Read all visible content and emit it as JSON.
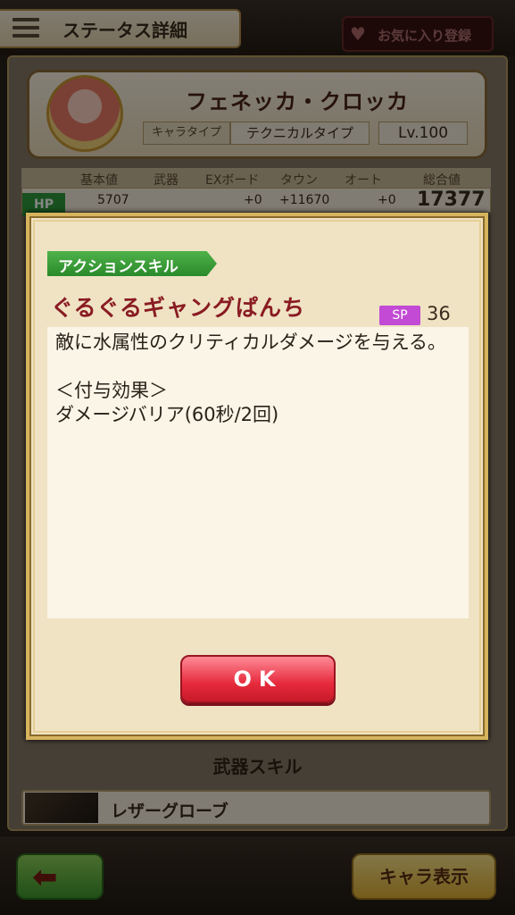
{
  "header": {
    "title": "ステータス詳細",
    "favorite_label": "お気に入り登録"
  },
  "character": {
    "name": "フェネッカ・クロッカ",
    "type_label": "キャラタイプ",
    "type_value": "テクニカルタイプ",
    "level": "Lv.100"
  },
  "stats": {
    "columns": [
      "基本値",
      "武器",
      "EXボード",
      "タウン",
      "オート",
      "総合値"
    ],
    "hp": {
      "label": "HP",
      "base": "5707",
      "exboard": "+0",
      "town": "+11670",
      "auto": "+0",
      "total": "17377"
    }
  },
  "weapon_skill": {
    "title": "武器スキル",
    "weapon_name": "レザーグローブ"
  },
  "footer": {
    "back_icon": "back-arrow-icon",
    "chara_label": "キャラ表示"
  },
  "modal": {
    "tag": "アクションスキル",
    "skill_name": "ぐるぐるギャングぱんち",
    "sp_label": "SP",
    "sp_value": "36",
    "description": "敵に水属性のクリティカルダメージを与える。\n\n＜付与効果＞\nダメージバリア(60秒/2回)",
    "ok_label": "OK"
  }
}
